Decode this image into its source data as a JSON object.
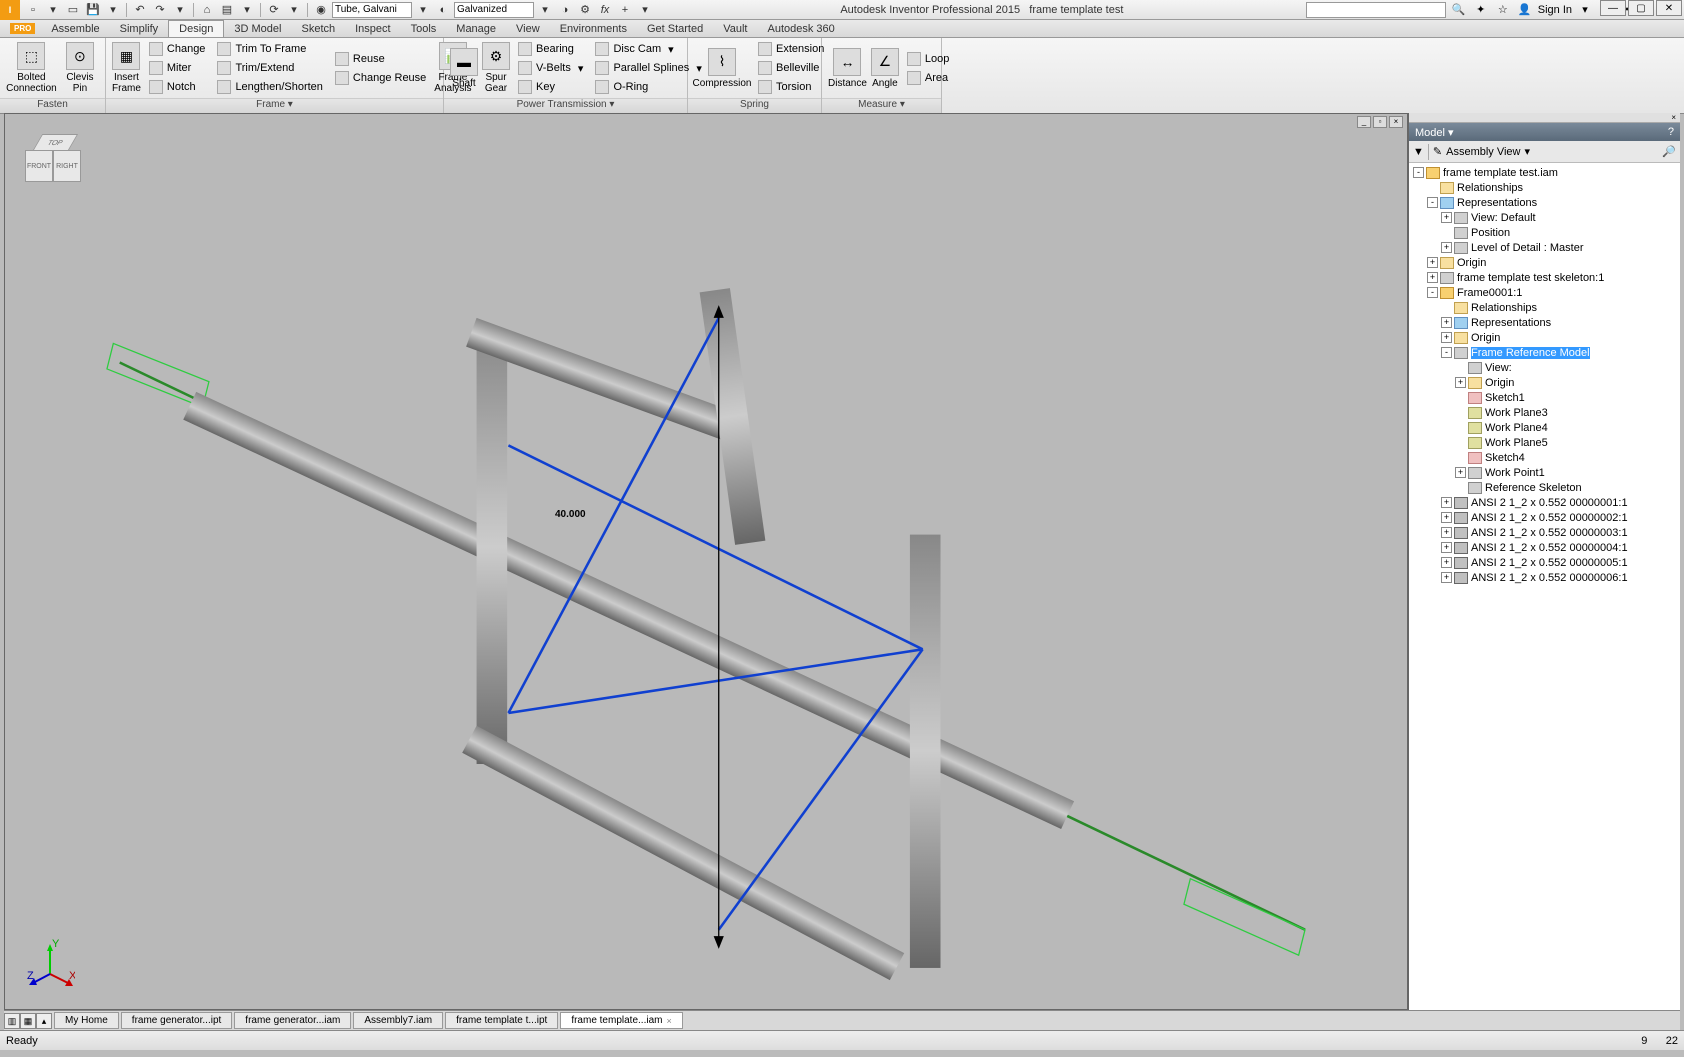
{
  "title": {
    "app": "Autodesk Inventor Professional 2015",
    "doc": "frame template test"
  },
  "qat": {
    "material": "Tube, Galvani",
    "appearance": "Galvanized"
  },
  "signin": "Sign In",
  "menutabs": [
    "Assemble",
    "Simplify",
    "Design",
    "3D Model",
    "Sketch",
    "Inspect",
    "Tools",
    "Manage",
    "View",
    "Environments",
    "Get Started",
    "Vault",
    "Autodesk 360"
  ],
  "active_tab": "Design",
  "ribbon": {
    "fasten": {
      "label": "Fasten",
      "bolted": "Bolted\nConnection",
      "clevis": "Clevis\nPin"
    },
    "frame": {
      "label": "Frame ▾",
      "insert": "Insert\nFrame",
      "change": "Change",
      "miter": "Miter",
      "notch": "Notch",
      "trimto": "Trim To Frame",
      "trimext": "Trim/Extend",
      "lengthen": "Lengthen/Shorten",
      "reuse": "Reuse",
      "changereuse": "Change Reuse",
      "analysis": "Frame\nAnalysis"
    },
    "power": {
      "label": "Power Transmission ▾",
      "shaft": "Shaft",
      "spur": "Spur\nGear",
      "bearing": "Bearing",
      "vbelts": "V-Belts",
      "key": "Key",
      "disccam": "Disc Cam",
      "parallel": "Parallel Splines",
      "oring": "O-Ring"
    },
    "spring": {
      "label": "Spring",
      "compression": "Compression",
      "extension": "Extension",
      "belleville": "Belleville",
      "torsion": "Torsion"
    },
    "measure": {
      "label": "Measure ▾",
      "distance": "Distance",
      "angle": "Angle",
      "loop": "Loop",
      "area": "Area"
    }
  },
  "viewport": {
    "dimension": "40.000"
  },
  "browser": {
    "title": "Model ▾",
    "view": "Assembly View",
    "tree": [
      {
        "d": 0,
        "e": "-",
        "i": "assy",
        "t": "frame template test.iam"
      },
      {
        "d": 1,
        "e": "",
        "i": "folder",
        "t": "Relationships"
      },
      {
        "d": 1,
        "e": "-",
        "i": "rep",
        "t": "Representations"
      },
      {
        "d": 2,
        "e": "+",
        "i": "part",
        "t": "View: Default"
      },
      {
        "d": 2,
        "e": "",
        "i": "part",
        "t": "Position"
      },
      {
        "d": 2,
        "e": "+",
        "i": "part",
        "t": "Level of Detail : Master"
      },
      {
        "d": 1,
        "e": "+",
        "i": "folder",
        "t": "Origin"
      },
      {
        "d": 1,
        "e": "+",
        "i": "part",
        "t": "frame template test skeleton:1"
      },
      {
        "d": 1,
        "e": "-",
        "i": "assy",
        "t": "Frame0001:1"
      },
      {
        "d": 2,
        "e": "",
        "i": "folder",
        "t": "Relationships"
      },
      {
        "d": 2,
        "e": "+",
        "i": "rep",
        "t": "Representations"
      },
      {
        "d": 2,
        "e": "+",
        "i": "folder",
        "t": "Origin"
      },
      {
        "d": 2,
        "e": "-",
        "i": "part",
        "t": "Frame Reference Model",
        "sel": true
      },
      {
        "d": 3,
        "e": "",
        "i": "part",
        "t": "View:"
      },
      {
        "d": 3,
        "e": "+",
        "i": "folder",
        "t": "Origin"
      },
      {
        "d": 3,
        "e": "",
        "i": "sketch",
        "t": "Sketch1"
      },
      {
        "d": 3,
        "e": "",
        "i": "plane",
        "t": "Work Plane3"
      },
      {
        "d": 3,
        "e": "",
        "i": "plane",
        "t": "Work Plane4"
      },
      {
        "d": 3,
        "e": "",
        "i": "plane",
        "t": "Work Plane5"
      },
      {
        "d": 3,
        "e": "",
        "i": "sketch",
        "t": "Sketch4"
      },
      {
        "d": 3,
        "e": "+",
        "i": "part",
        "t": "Work Point1"
      },
      {
        "d": 3,
        "e": "",
        "i": "part",
        "t": "Reference Skeleton"
      },
      {
        "d": 2,
        "e": "+",
        "i": "ibeam",
        "t": "ANSI 2 1_2 x 0.552 00000001:1"
      },
      {
        "d": 2,
        "e": "+",
        "i": "ibeam",
        "t": "ANSI 2 1_2 x 0.552 00000002:1"
      },
      {
        "d": 2,
        "e": "+",
        "i": "ibeam",
        "t": "ANSI 2 1_2 x 0.552 00000003:1"
      },
      {
        "d": 2,
        "e": "+",
        "i": "ibeam",
        "t": "ANSI 2 1_2 x 0.552 00000004:1"
      },
      {
        "d": 2,
        "e": "+",
        "i": "ibeam",
        "t": "ANSI 2 1_2 x 0.552 00000005:1"
      },
      {
        "d": 2,
        "e": "+",
        "i": "ibeam",
        "t": "ANSI 2 1_2 x 0.552 00000006:1"
      }
    ]
  },
  "doctabs": [
    "My Home",
    "frame generator...ipt",
    "frame generator...iam",
    "Assembly7.iam",
    "frame template t...ipt",
    "frame template...iam"
  ],
  "doctab_active": 5,
  "status": {
    "left": "Ready",
    "right1": "9",
    "right2": "22"
  }
}
